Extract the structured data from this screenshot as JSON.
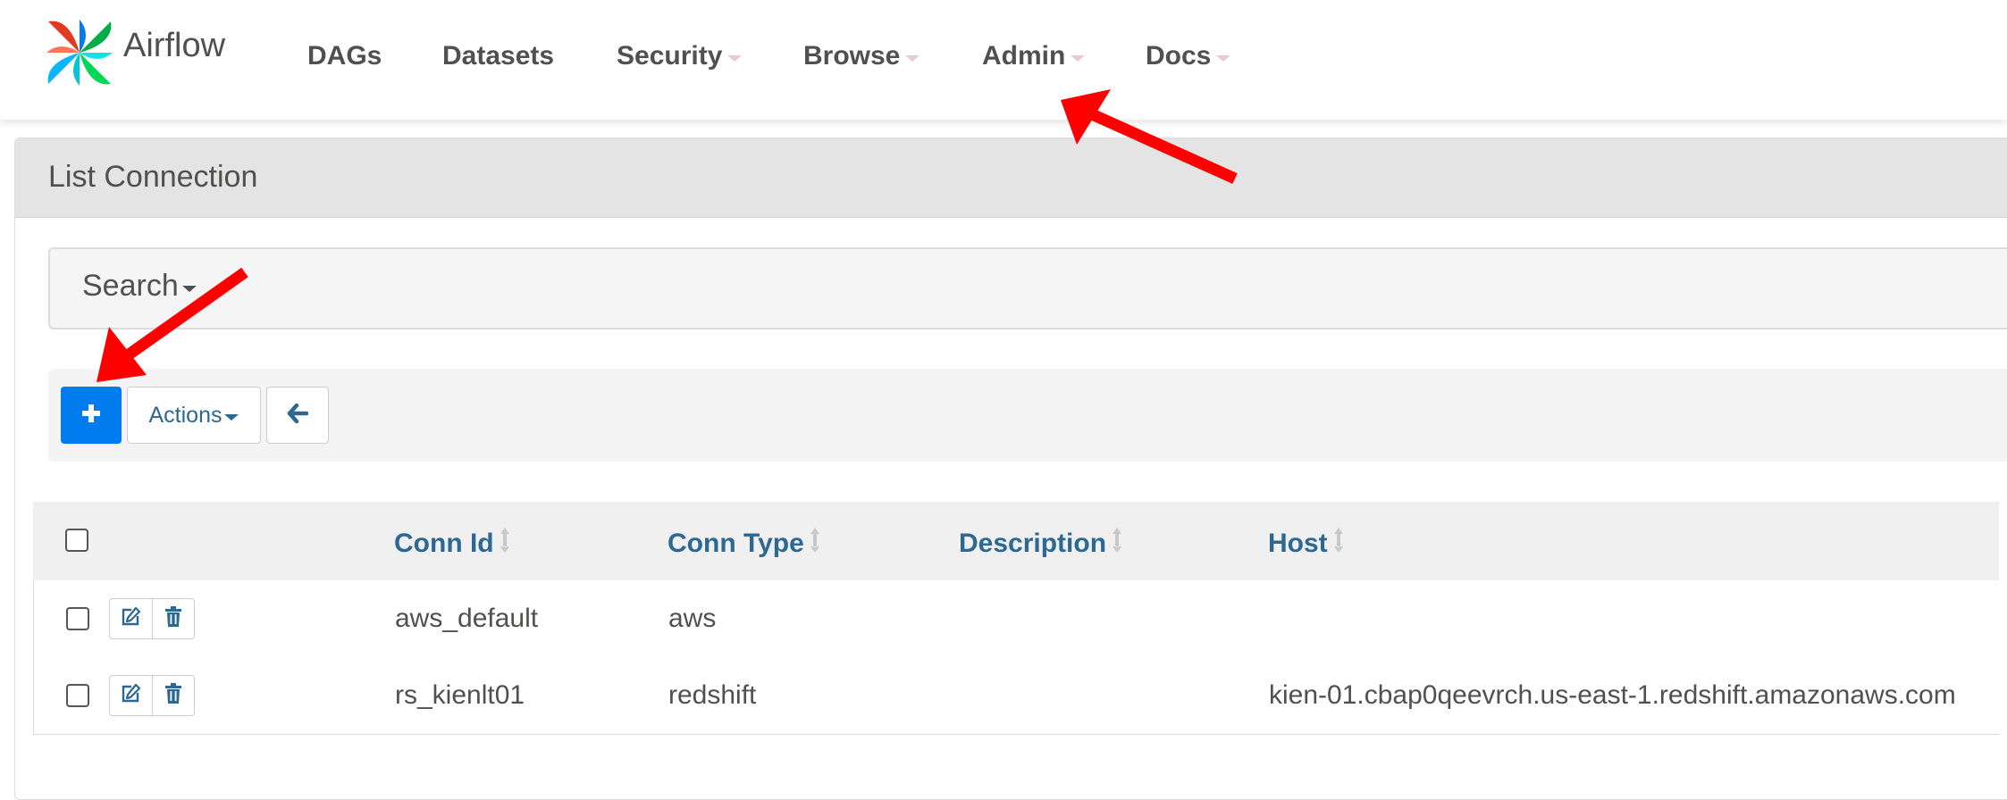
{
  "brand": {
    "name": "Airflow"
  },
  "nav": {
    "items": [
      {
        "label": "DAGs",
        "dropdown": false
      },
      {
        "label": "Datasets",
        "dropdown": false
      },
      {
        "label": "Security",
        "dropdown": true
      },
      {
        "label": "Browse",
        "dropdown": true
      },
      {
        "label": "Admin",
        "dropdown": true
      },
      {
        "label": "Docs",
        "dropdown": true
      }
    ]
  },
  "page": {
    "title": "List Connection"
  },
  "search": {
    "label": "Search"
  },
  "toolbar": {
    "add_icon": "plus-icon",
    "actions_label": "Actions",
    "back_icon": "arrow-left-icon"
  },
  "table": {
    "columns": [
      "Conn Id",
      "Conn Type",
      "Description",
      "Host"
    ],
    "rows": [
      {
        "conn_id": "aws_default",
        "conn_type": "aws",
        "description": "",
        "host": ""
      },
      {
        "conn_id": "rs_kienlt01",
        "conn_type": "redshift",
        "description": "",
        "host": "kien-01.cbap0qeevrch.us-east-1.redshift.amazonaws.com"
      }
    ],
    "row_icons": [
      "edit-icon",
      "trash-icon"
    ]
  },
  "colors": {
    "accent": "#017cee",
    "header_link": "#2c6892",
    "annotation": "#ff0000",
    "panel_heading": "#e4e4e4"
  }
}
